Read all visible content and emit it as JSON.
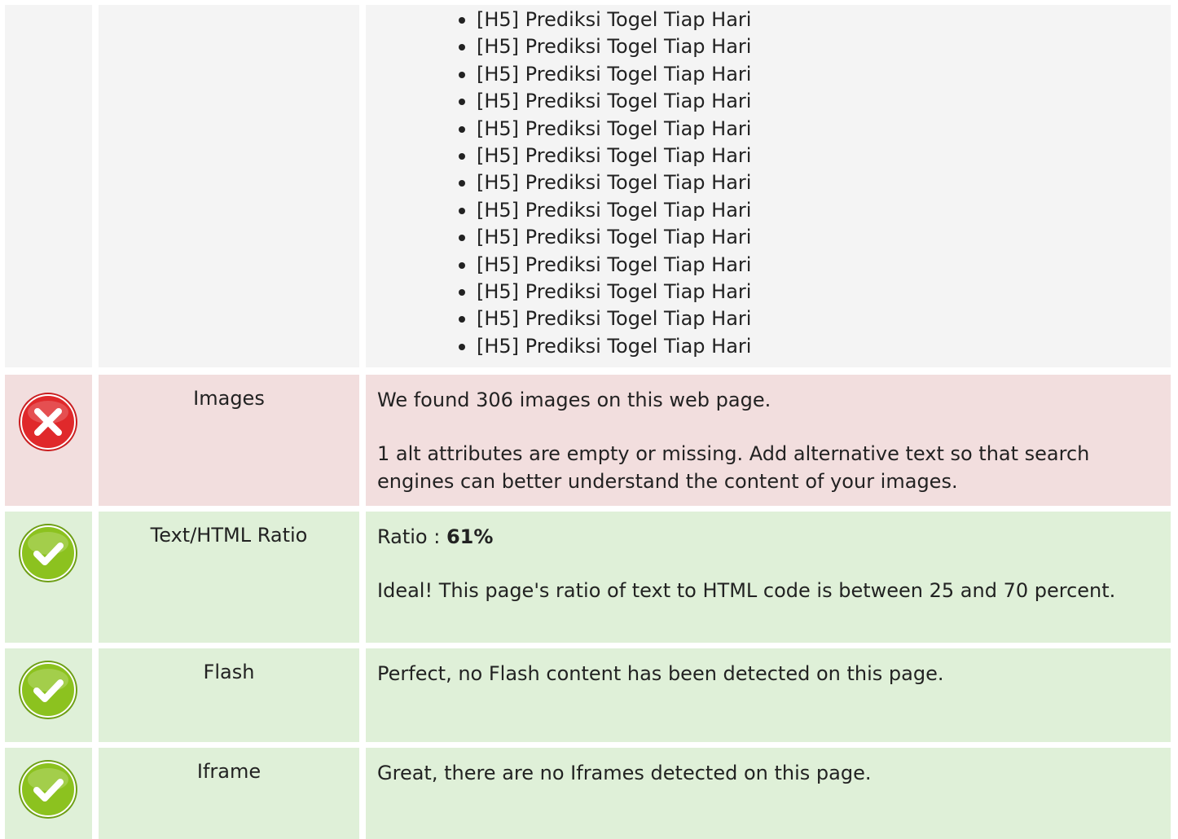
{
  "headings_list": {
    "items": [
      "[H5] Prediksi Togel Tiap Hari",
      "[H5] Prediksi Togel Tiap Hari",
      "[H5] Prediksi Togel Tiap Hari",
      "[H5] Prediksi Togel Tiap Hari",
      "[H5] Prediksi Togel Tiap Hari",
      "[H5] Prediksi Togel Tiap Hari",
      "[H5] Prediksi Togel Tiap Hari",
      "[H5] Prediksi Togel Tiap Hari",
      "[H5] Prediksi Togel Tiap Hari",
      "[H5] Prediksi Togel Tiap Hari",
      "[H5] Prediksi Togel Tiap Hari",
      "[H5] Prediksi Togel Tiap Hari",
      "[H5] Prediksi Togel Tiap Hari"
    ]
  },
  "checks": {
    "images": {
      "status": "error",
      "status_icon": "error-x-icon",
      "label": "Images",
      "line1": "We found 306 images on this web page.",
      "line2": "1 alt attributes are empty or missing. Add alternative text so that search engines can better understand the content of your images."
    },
    "text_html_ratio": {
      "status": "ok",
      "status_icon": "check-icon",
      "label": "Text/HTML Ratio",
      "ratio_prefix": "Ratio : ",
      "ratio_value": "61%",
      "line2": "Ideal! This page's ratio of text to HTML code is between 25 and 70 percent."
    },
    "flash": {
      "status": "ok",
      "status_icon": "check-icon",
      "label": "Flash",
      "line1": "Perfect, no Flash content has been detected on this page."
    },
    "iframe": {
      "status": "ok",
      "status_icon": "check-icon",
      "label": "Iframe",
      "line1": "Great, there are no Iframes detected on this page."
    }
  },
  "colors": {
    "neutral_bg": "#f4f4f4",
    "error_bg": "#f2dede",
    "ok_bg": "#dff0d8",
    "error_icon": "#e0292b",
    "ok_icon": "#8cc21f"
  }
}
